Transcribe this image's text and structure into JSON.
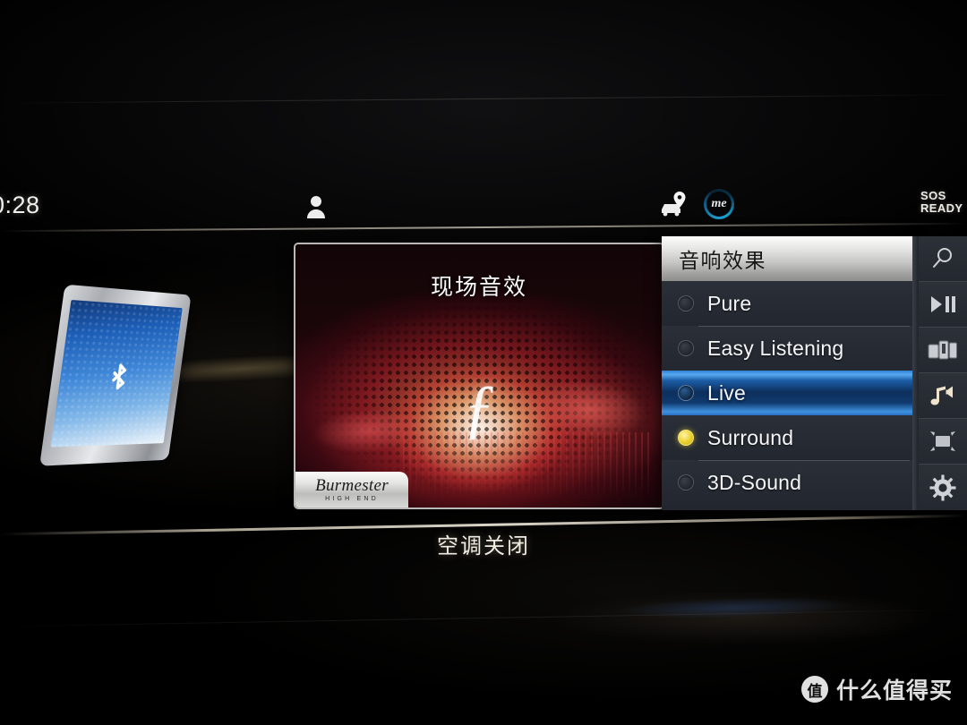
{
  "status_bar": {
    "clock": "0:28",
    "person_icon": "person-icon",
    "car_location_icon": "car-location-pin-icon",
    "me_logo_label": "me",
    "sos_line1": "SOS",
    "sos_line2": "READY"
  },
  "album_art": {
    "title": "现场音效",
    "center_mark": "ƒ",
    "brand": "Burmester",
    "brand_subtitle": "HIGH END",
    "accent_color": "#d8323c",
    "glow_color": "#ffd9a0"
  },
  "sound_menu": {
    "header": "音响效果",
    "highlight_color": "#2f7fd6",
    "selected_radio_color": "#e9cf2c",
    "items": [
      {
        "label": "Pure",
        "selected": false,
        "highlighted": false
      },
      {
        "label": "Easy Listening",
        "selected": false,
        "highlighted": false
      },
      {
        "label": "Live",
        "selected": false,
        "highlighted": true
      },
      {
        "label": "Surround",
        "selected": true,
        "highlighted": false
      },
      {
        "label": "3D-Sound",
        "selected": false,
        "highlighted": false
      }
    ]
  },
  "icon_bar": {
    "items": [
      {
        "name": "search-icon"
      },
      {
        "name": "play-pause-icon"
      },
      {
        "name": "media-devices-icon"
      },
      {
        "name": "sound-output-icon"
      },
      {
        "name": "fullscreen-icon"
      },
      {
        "name": "settings-gear-icon"
      }
    ]
  },
  "bluetooth_device": {
    "icon": "bluetooth-icon",
    "device": "smartphone"
  },
  "climate": {
    "status": "空调关闭"
  },
  "watermark": {
    "badge": "值",
    "text": "什么值得买"
  }
}
